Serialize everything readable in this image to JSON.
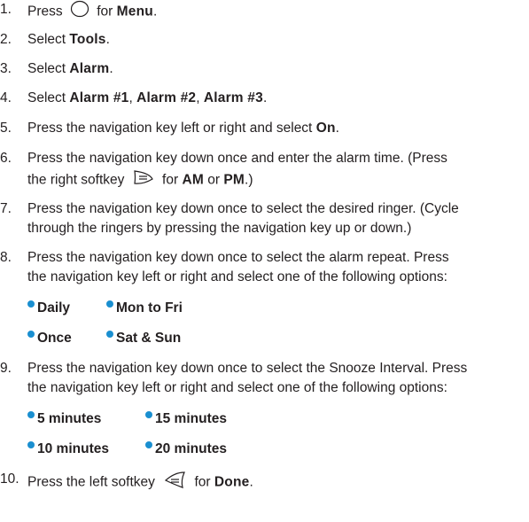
{
  "steps": [
    {
      "n": "1.",
      "parts": [
        "Press",
        "for",
        "Menu",
        "."
      ]
    },
    {
      "n": "2.",
      "parts": [
        "Select",
        "Tools",
        "."
      ]
    },
    {
      "n": "3.",
      "parts": [
        "Select",
        "Alarm",
        "."
      ]
    },
    {
      "n": "4.",
      "parts": [
        "Select",
        "Alarm #1",
        ", ",
        "Alarm #2",
        ", ",
        "Alarm #3",
        "."
      ]
    },
    {
      "n": "5.",
      "parts": [
        "Press the navigation key left or right and select",
        "On",
        "."
      ]
    },
    {
      "n": "6.",
      "parts": [
        "Press the navigation key down once and enter the alarm time. (Press",
        "the right softkey",
        "for",
        "AM",
        "or",
        "PM",
        ".)"
      ]
    },
    {
      "n": "7.",
      "parts": [
        "Press the navigation key down once to select the desired ringer. (Cycle",
        "through the ringers by pressing the navigation key up or down.)"
      ]
    },
    {
      "n": "8.",
      "parts": [
        "Press the navigation key down once to select the alarm repeat. Press",
        "the navigation key left or right and select one of the following options:"
      ]
    },
    {
      "n": "9.",
      "parts": [
        "Press the navigation key down once to select the Snooze Interval. Press",
        "the navigation key left or right and select one of the following options:"
      ]
    },
    {
      "n": "10.",
      "parts": [
        "Press the left softkey",
        "for",
        "Done",
        "."
      ]
    }
  ],
  "repeat_options": [
    "Daily",
    "Mon to Fri",
    "Once",
    "Sat & Sun"
  ],
  "snooze_options": [
    "5 minutes",
    "15 minutes",
    "10 minutes",
    "20 minutes"
  ],
  "icons": [
    "menu-key-icon",
    "right-softkey-icon",
    "left-softkey-icon"
  ],
  "colors": {
    "bullet": "#1a8fd0",
    "text": "#231f20"
  }
}
